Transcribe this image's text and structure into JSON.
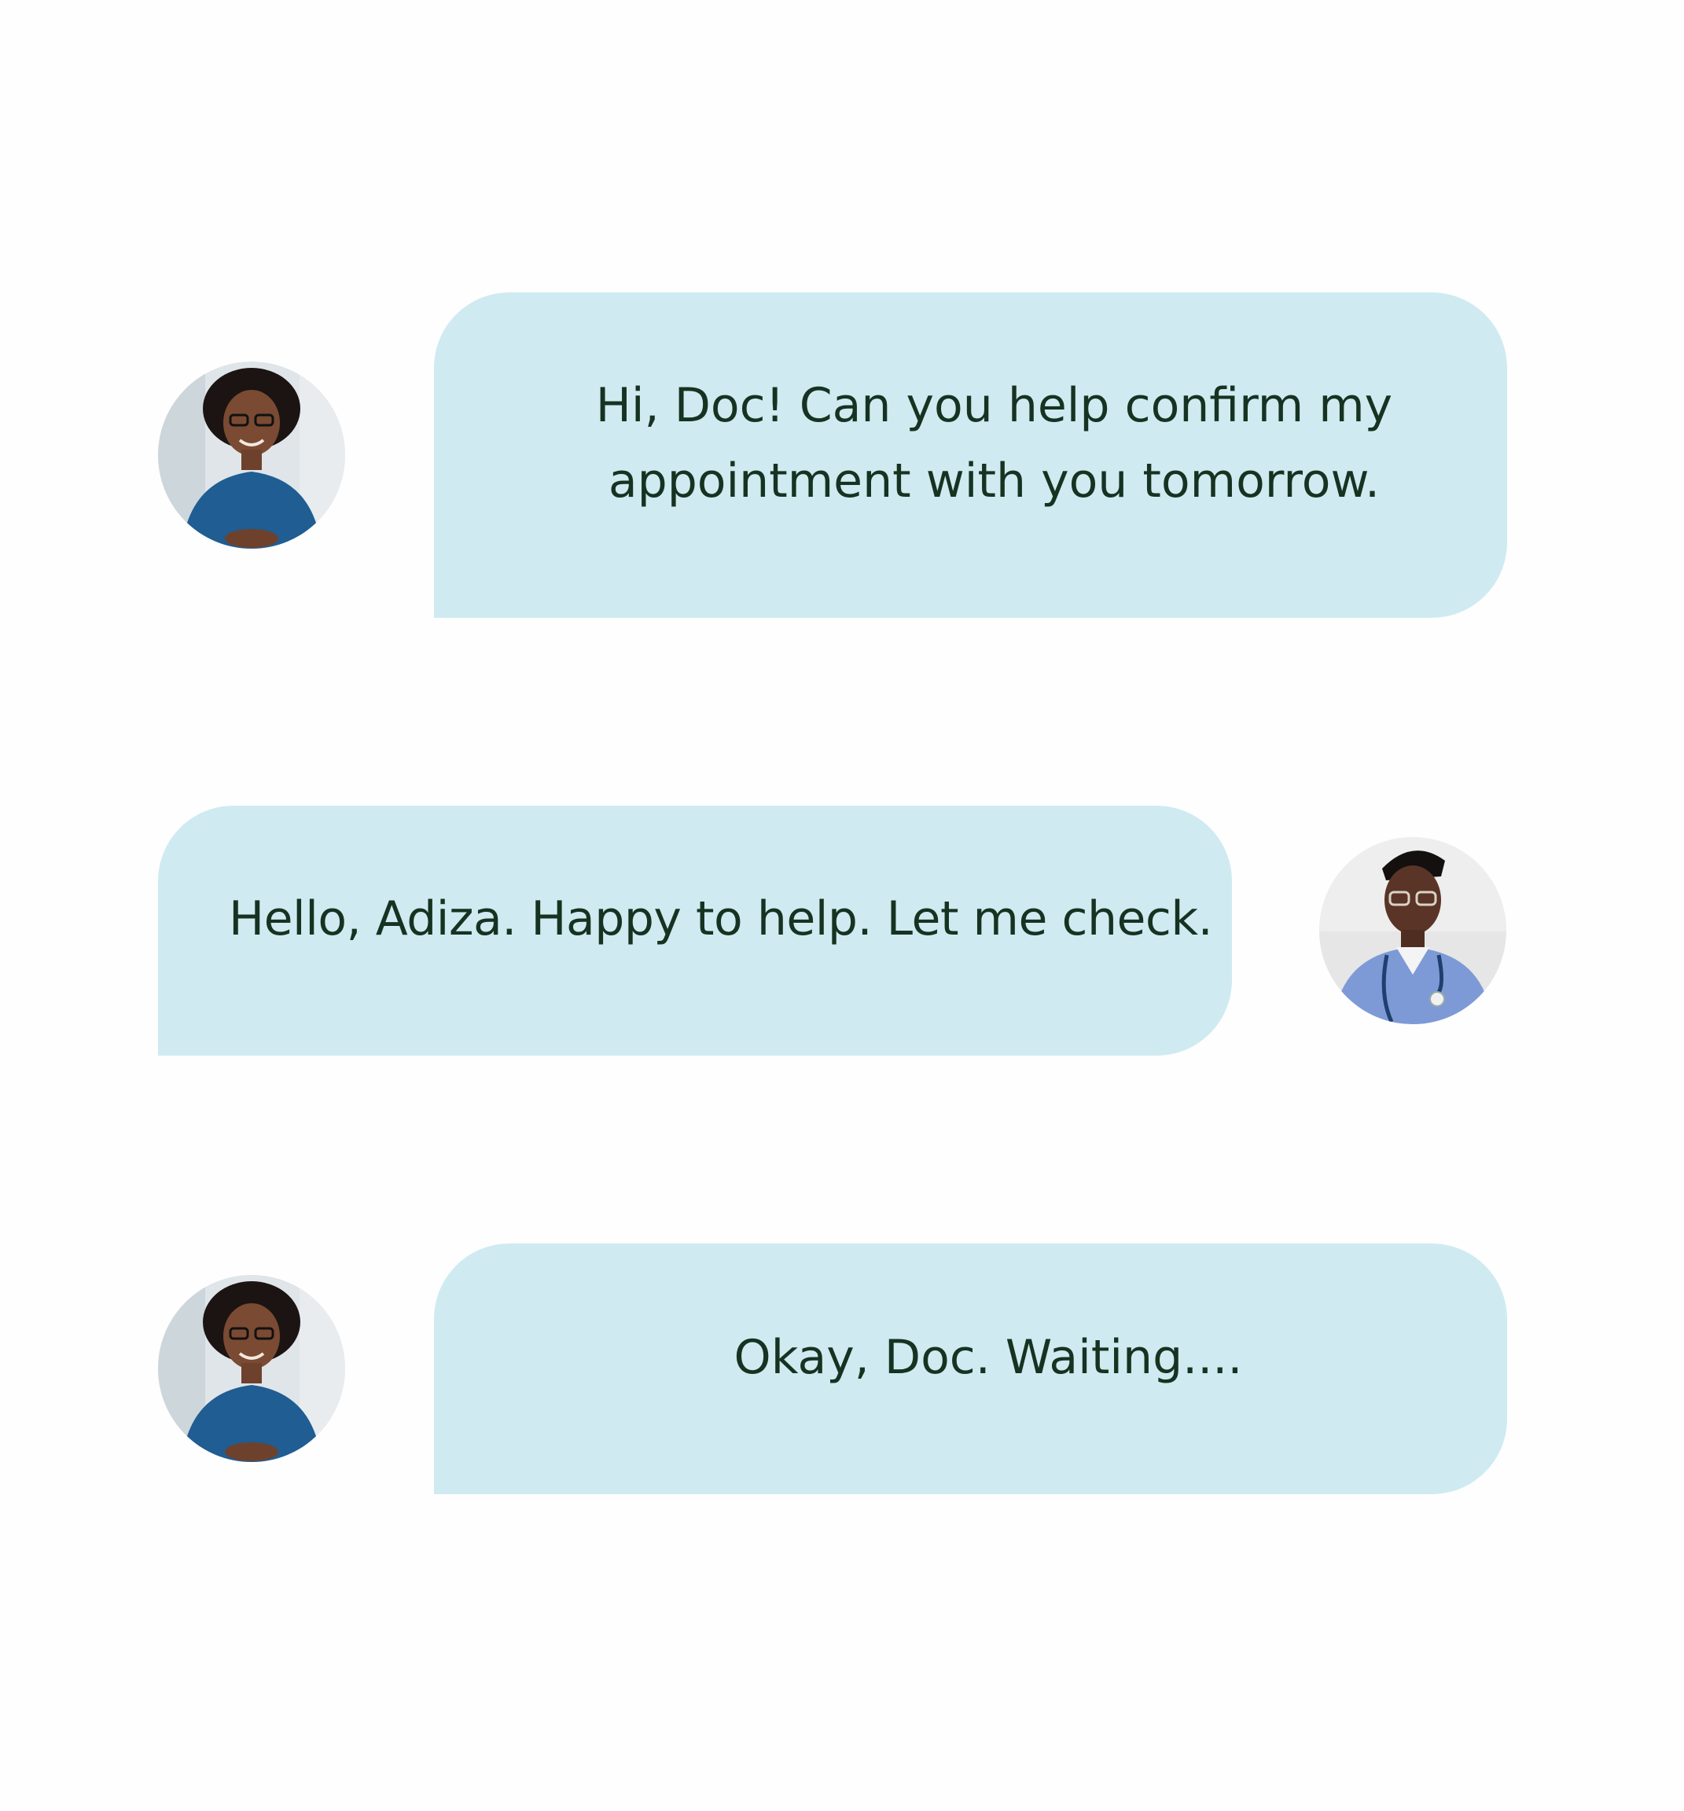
{
  "conversation": {
    "messages": [
      {
        "sender": "patient",
        "lines": [
          "Hi, Doc! Can you help confirm my",
          "appointment with you tomorrow."
        ]
      },
      {
        "sender": "doctor",
        "text": "Hello, Adiza. Happy to help. Let me check."
      },
      {
        "sender": "patient",
        "text": "Okay, Doc. Waiting...."
      }
    ]
  },
  "avatars": {
    "patient_icon": "woman-portrait-avatar",
    "doctor_icon": "doctor-portrait-avatar"
  },
  "colors": {
    "bubble_bg": "#cfebf1",
    "text": "#163322",
    "page_bg": "#fefefe"
  }
}
